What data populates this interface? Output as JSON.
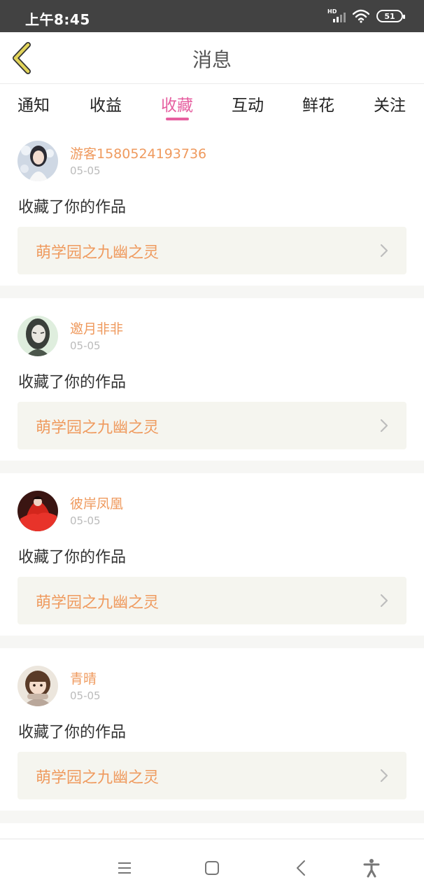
{
  "status_bar": {
    "time": "上午8:45",
    "hd_label": "HD",
    "battery": "51",
    "icons": [
      "signal-icon",
      "wifi-icon",
      "battery-icon"
    ]
  },
  "header": {
    "title": "消息",
    "back_icon": "chevron-left-icon",
    "back_icon_color": "#d9c94a"
  },
  "tabs": [
    {
      "label": "通知",
      "active": false
    },
    {
      "label": "收益",
      "active": false
    },
    {
      "label": "收藏",
      "active": true
    },
    {
      "label": "互动",
      "active": false
    },
    {
      "label": "鲜花",
      "active": false
    },
    {
      "label": "关注",
      "active": false
    }
  ],
  "feed": [
    {
      "user": "游客1580524193736",
      "date": "05-05",
      "action": "收藏了你的作品",
      "work_title": "萌学园之九幽之灵"
    },
    {
      "user": "邀月非非",
      "date": "05-05",
      "action": "收藏了你的作品",
      "work_title": "萌学园之九幽之灵"
    },
    {
      "user": "彼岸凤凰",
      "date": "05-05",
      "action": "收藏了你的作品",
      "work_title": "萌学园之九幽之灵"
    },
    {
      "user": "青晴",
      "date": "05-05",
      "action": "收藏了你的作品",
      "work_title": "萌学园之九幽之灵"
    }
  ],
  "nav_bar": {
    "icons": [
      "menu-icon",
      "home-square-icon",
      "back-triangle-icon",
      "accessibility-icon"
    ]
  },
  "colors": {
    "accent_pink": "#e65fa0",
    "name_orange": "#ef9a5e",
    "status_bar_bg": "#424242",
    "work_box_bg": "#f5f5ef"
  }
}
